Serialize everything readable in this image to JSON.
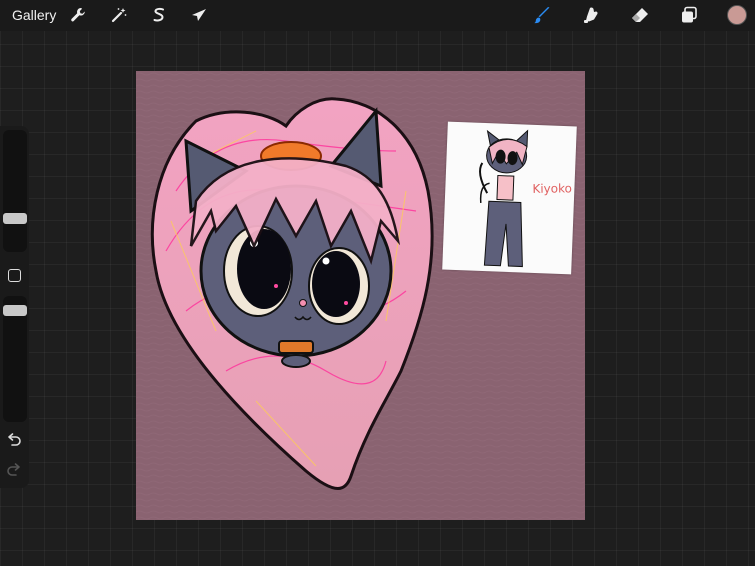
{
  "topbar": {
    "gallery_label": "Gallery",
    "left_tools": [
      {
        "name": "actions",
        "icon": "wrench-icon"
      },
      {
        "name": "adjustments",
        "icon": "magic-wand-icon"
      },
      {
        "name": "selection",
        "icon": "selection-s-icon"
      },
      {
        "name": "transform",
        "icon": "arrow-cursor-icon"
      }
    ],
    "right_tools": [
      {
        "name": "brush",
        "icon": "brush-icon",
        "active": true
      },
      {
        "name": "smudge",
        "icon": "smudge-icon",
        "active": false
      },
      {
        "name": "eraser",
        "icon": "eraser-icon",
        "active": false
      },
      {
        "name": "layers",
        "icon": "layers-icon",
        "active": false
      }
    ],
    "current_color": "#c99a95",
    "active_tool_color": "#2a8bf2"
  },
  "sidebar": {
    "brush_size_level": 0.22,
    "opacity_level": 0.1,
    "modify_button_icon": "square-icon",
    "undo_icon": "undo-icon",
    "redo_icon": "redo-icon"
  },
  "canvas": {
    "background_color": "#8a6371",
    "reference_card": {
      "character_name": "Kiyoko"
    }
  }
}
